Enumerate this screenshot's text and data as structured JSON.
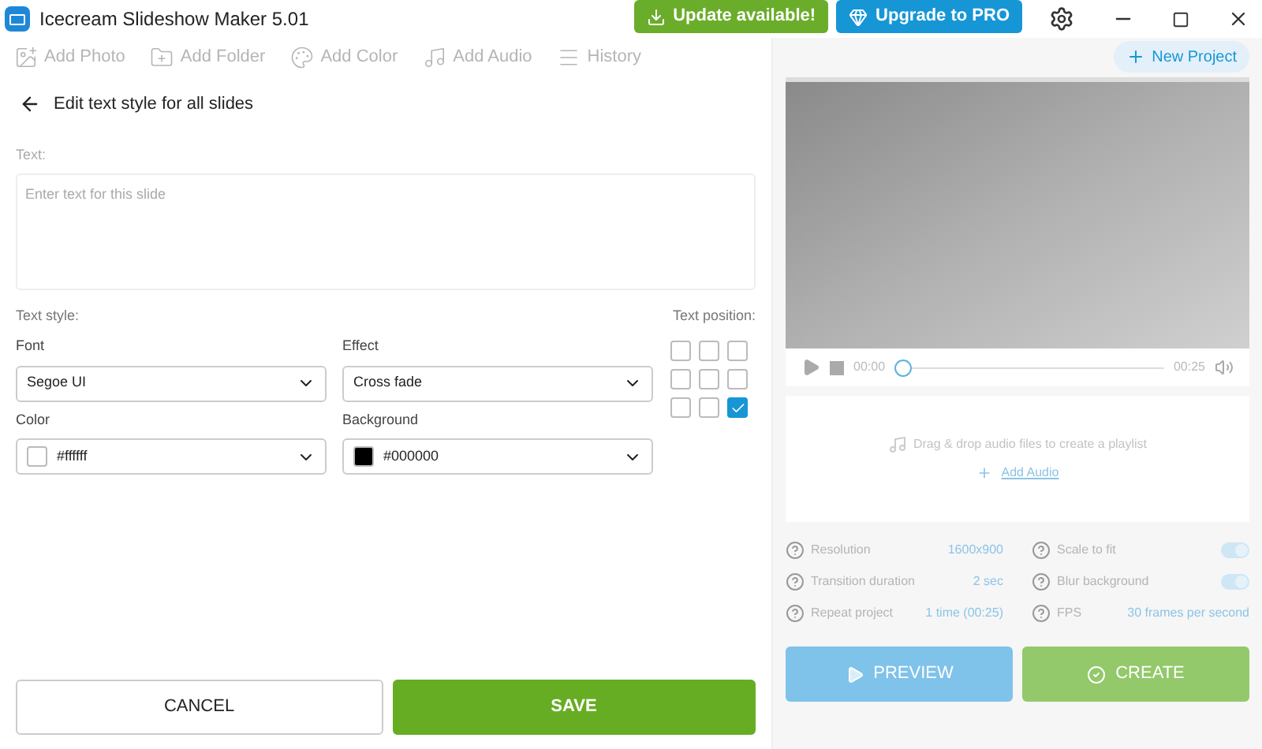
{
  "window": {
    "title": "Icecream Slideshow Maker 5.01"
  },
  "header_buttons": [
    {
      "label": "Update available!",
      "kind": "update"
    },
    {
      "label": "Upgrade to PRO",
      "kind": "pro"
    }
  ],
  "toolbar": [
    {
      "label": "Add Photo",
      "kind": "photo",
      "disabled": true
    },
    {
      "label": "Add Folder",
      "kind": "folder",
      "disabled": true
    },
    {
      "label": "Add Color",
      "kind": "color",
      "disabled": true
    },
    {
      "label": "Add Audio",
      "kind": "audio",
      "disabled": true
    },
    {
      "label": "History",
      "kind": "history",
      "disabled": true
    }
  ],
  "new_project": "New Project",
  "editor": {
    "title": "Edit text style for all slides",
    "text_label": "Text:",
    "text_placeholder": "Enter text for this slide",
    "style_label": "Text style:",
    "fields": [
      {
        "label": "Font",
        "value": "Segoe UI",
        "kind": "plain"
      },
      {
        "label": "Effect",
        "value": "Cross fade",
        "kind": "plain"
      },
      {
        "label": "Color",
        "value": "#ffffff",
        "kind": "swatch",
        "color": "#ffffff"
      },
      {
        "label": "Background",
        "value": "#000000",
        "kind": "swatch",
        "color": "#000000"
      }
    ],
    "position_label": "Text position:",
    "positions": [
      {
        "selected": false
      },
      {
        "selected": false
      },
      {
        "selected": false
      },
      {
        "selected": false
      },
      {
        "selected": false
      },
      {
        "selected": false
      },
      {
        "selected": false
      },
      {
        "selected": false
      },
      {
        "selected": true
      }
    ],
    "buttons": [
      {
        "label": "CANCEL",
        "kind": "secondary"
      },
      {
        "label": "SAVE",
        "kind": "primary"
      }
    ]
  },
  "player": {
    "start": "00:00",
    "end": "00:25",
    "level": 0
  },
  "audio": {
    "hint": "Drag & drop audio files to create a playlist",
    "link": "Add Audio"
  },
  "settings": [
    {
      "label": "Resolution",
      "value": "1600x900",
      "kind": "value"
    },
    {
      "label": "Scale to fit",
      "kind": "toggle",
      "on": true
    },
    {
      "label": "Transition duration",
      "value": "2 sec",
      "kind": "value"
    },
    {
      "label": "Blur background",
      "kind": "toggle",
      "on": true
    },
    {
      "label": "Repeat project",
      "value": "1 time (00:25)",
      "kind": "value"
    },
    {
      "label": "FPS",
      "value": "30 frames per second",
      "kind": "value"
    }
  ],
  "actions": [
    {
      "label": "PREVIEW",
      "kind": "preview",
      "disabled": true
    },
    {
      "label": "CREATE",
      "kind": "create",
      "disabled": true
    }
  ]
}
